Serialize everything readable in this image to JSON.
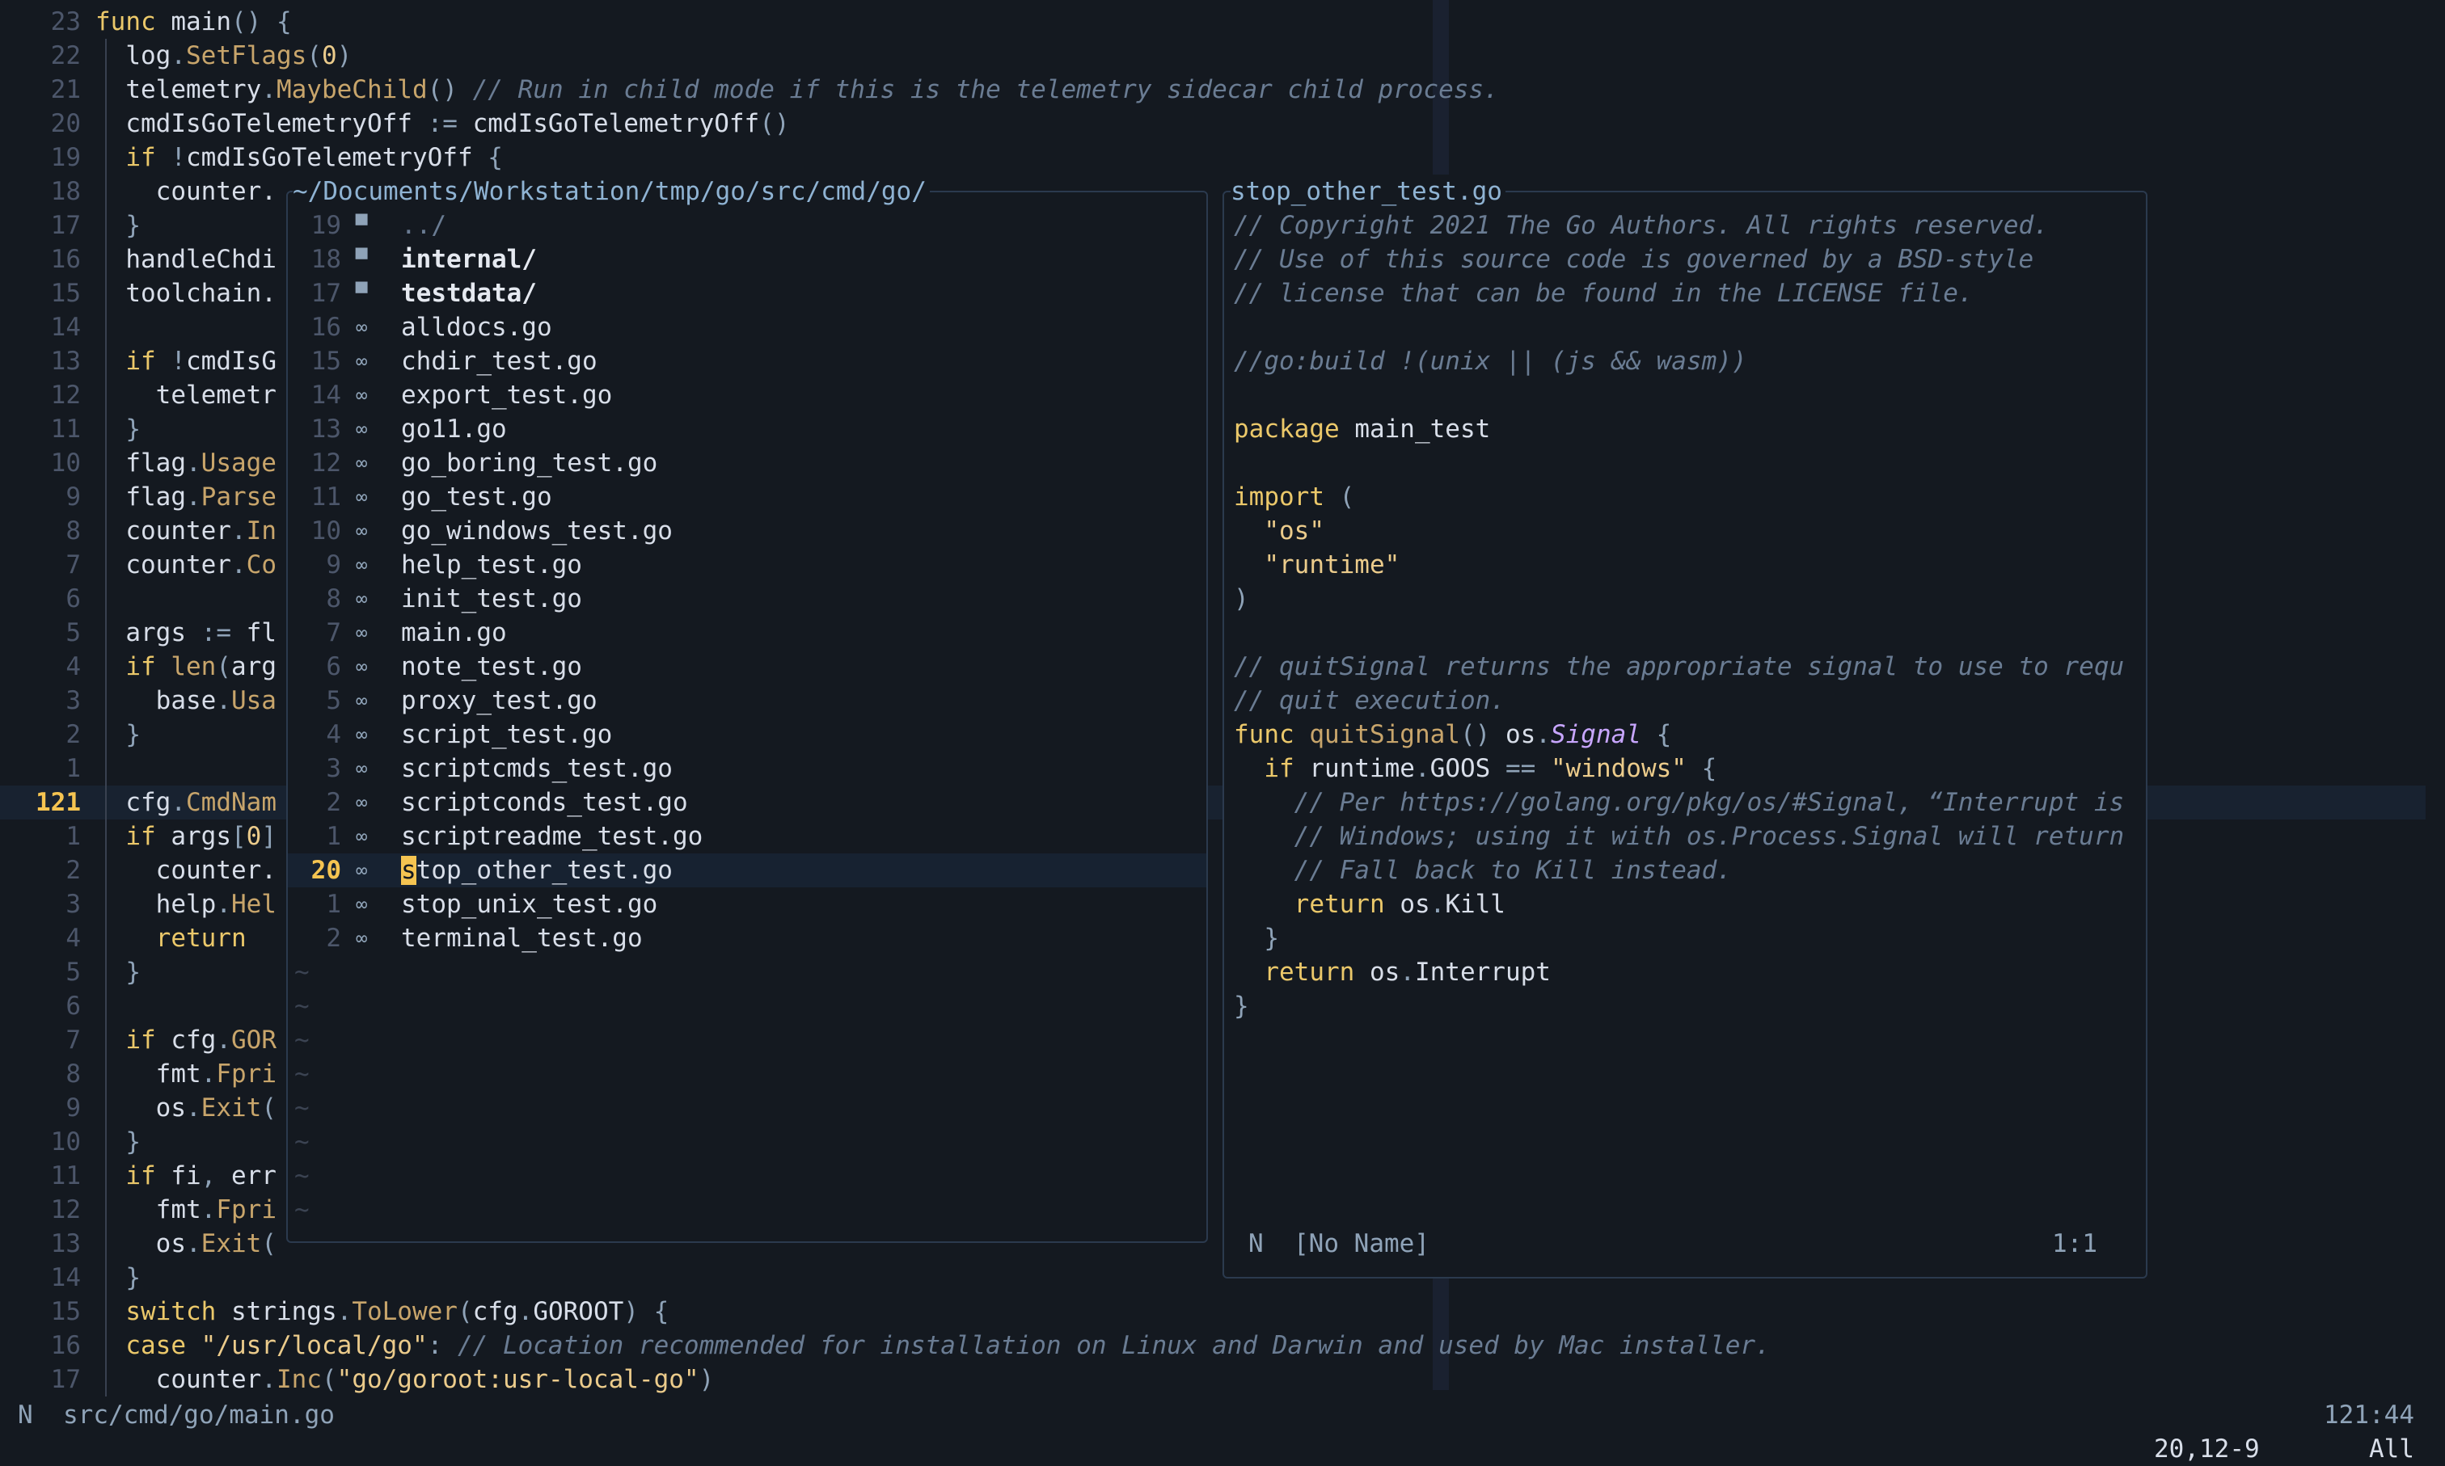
{
  "editor": {
    "cursor_line_number": "121",
    "lines": [
      {
        "n": "23",
        "segs": [
          [
            "kw",
            "func "
          ],
          [
            "",
            "main"
          ],
          [
            "op",
            "() {"
          ]
        ]
      },
      {
        "n": "22",
        "segs": [
          [
            "",
            "  log"
          ],
          [
            "op",
            "."
          ],
          [
            "fn",
            "SetFlags"
          ],
          [
            "op",
            "("
          ],
          [
            "num",
            "0"
          ],
          [
            "op",
            ")"
          ]
        ]
      },
      {
        "n": "21",
        "segs": [
          [
            "",
            "  telemetry"
          ],
          [
            "op",
            "."
          ],
          [
            "fn",
            "MaybeChild"
          ],
          [
            "op",
            "() "
          ],
          [
            "cm",
            "// Run in child mode if this is the telemetry sidecar child process."
          ]
        ]
      },
      {
        "n": "20",
        "segs": [
          [
            "",
            "  cmdIsGoTelemetryOff "
          ],
          [
            "op",
            ":= "
          ],
          [
            "",
            "cmdIsGoTelemetryOff"
          ],
          [
            "op",
            "()"
          ]
        ]
      },
      {
        "n": "19",
        "segs": [
          [
            "kw",
            "  if "
          ],
          [
            "op",
            "!"
          ],
          [
            "",
            "cmdIsGoTelemetryOff "
          ],
          [
            "op",
            "{"
          ]
        ]
      },
      {
        "n": "18",
        "segs": [
          [
            "",
            "    counter."
          ]
        ]
      },
      {
        "n": "17",
        "segs": [
          [
            "op",
            "  }"
          ]
        ]
      },
      {
        "n": "16",
        "segs": [
          [
            "",
            "  handleChdi"
          ]
        ]
      },
      {
        "n": "15",
        "segs": [
          [
            "",
            "  toolchain."
          ]
        ]
      },
      {
        "n": "14",
        "segs": []
      },
      {
        "n": "13",
        "segs": [
          [
            "kw",
            "  if "
          ],
          [
            "op",
            "!"
          ],
          [
            "",
            "cmdIsG"
          ]
        ]
      },
      {
        "n": "12",
        "segs": [
          [
            "",
            "    telemetr"
          ]
        ]
      },
      {
        "n": "11",
        "segs": [
          [
            "op",
            "  }"
          ]
        ]
      },
      {
        "n": "10",
        "segs": [
          [
            "",
            "  flag"
          ],
          [
            "op",
            "."
          ],
          [
            "fn",
            "Usage"
          ]
        ]
      },
      {
        "n": "9",
        "segs": [
          [
            "",
            "  flag"
          ],
          [
            "op",
            "."
          ],
          [
            "fn",
            "Parse"
          ]
        ]
      },
      {
        "n": "8",
        "segs": [
          [
            "",
            "  counter"
          ],
          [
            "op",
            "."
          ],
          [
            "fn",
            "In"
          ]
        ]
      },
      {
        "n": "7",
        "segs": [
          [
            "",
            "  counter"
          ],
          [
            "op",
            "."
          ],
          [
            "fn",
            "Co"
          ]
        ]
      },
      {
        "n": "6",
        "segs": []
      },
      {
        "n": "5",
        "segs": [
          [
            "",
            "  args "
          ],
          [
            "op",
            ":= "
          ],
          [
            "",
            "fl"
          ]
        ]
      },
      {
        "n": "4",
        "segs": [
          [
            "kw",
            "  if "
          ],
          [
            "fn",
            "len"
          ],
          [
            "op",
            "("
          ],
          [
            "",
            "arg"
          ]
        ]
      },
      {
        "n": "3",
        "segs": [
          [
            "",
            "    base"
          ],
          [
            "op",
            "."
          ],
          [
            "fn",
            "Usa"
          ]
        ]
      },
      {
        "n": "2",
        "segs": [
          [
            "op",
            "  }"
          ]
        ]
      },
      {
        "n": "1",
        "segs": []
      },
      {
        "n": "121",
        "segs": [
          [
            "",
            "  cfg"
          ],
          [
            "op",
            "."
          ],
          [
            "fn",
            "CmdNam"
          ]
        ]
      },
      {
        "n": "1",
        "segs": [
          [
            "kw",
            "  if "
          ],
          [
            "",
            "args"
          ],
          [
            "op",
            "["
          ],
          [
            "num",
            "0"
          ],
          [
            "op",
            "]"
          ]
        ]
      },
      {
        "n": "2",
        "segs": [
          [
            "",
            "    counter."
          ]
        ]
      },
      {
        "n": "3",
        "segs": [
          [
            "",
            "    help"
          ],
          [
            "op",
            "."
          ],
          [
            "fn",
            "Hel"
          ]
        ]
      },
      {
        "n": "4",
        "segs": [
          [
            "kw",
            "    return"
          ]
        ]
      },
      {
        "n": "5",
        "segs": [
          [
            "op",
            "  }"
          ]
        ]
      },
      {
        "n": "6",
        "segs": []
      },
      {
        "n": "7",
        "segs": [
          [
            "kw",
            "  if "
          ],
          [
            "",
            "cfg"
          ],
          [
            "op",
            "."
          ],
          [
            "fn",
            "GOR"
          ]
        ]
      },
      {
        "n": "8",
        "segs": [
          [
            "",
            "    fmt"
          ],
          [
            "op",
            "."
          ],
          [
            "fn",
            "Fpri"
          ]
        ]
      },
      {
        "n": "9",
        "segs": [
          [
            "",
            "    os"
          ],
          [
            "op",
            "."
          ],
          [
            "fn",
            "Exit"
          ],
          [
            "op",
            "("
          ]
        ]
      },
      {
        "n": "10",
        "segs": [
          [
            "op",
            "  }"
          ]
        ]
      },
      {
        "n": "11",
        "segs": [
          [
            "kw",
            "  if "
          ],
          [
            "",
            "fi"
          ],
          [
            "op",
            ", "
          ],
          [
            "",
            "err"
          ]
        ]
      },
      {
        "n": "12",
        "segs": [
          [
            "",
            "    fmt"
          ],
          [
            "op",
            "."
          ],
          [
            "fn",
            "Fpri"
          ]
        ]
      },
      {
        "n": "13",
        "segs": [
          [
            "",
            "    os"
          ],
          [
            "op",
            "."
          ],
          [
            "fn",
            "Exit"
          ],
          [
            "op",
            "("
          ]
        ]
      },
      {
        "n": "14",
        "segs": [
          [
            "op",
            "  }"
          ]
        ]
      },
      {
        "n": "15",
        "segs": [
          [
            "kw",
            "  switch "
          ],
          [
            "",
            "strings"
          ],
          [
            "op",
            "."
          ],
          [
            "fn",
            "ToLower"
          ],
          [
            "op",
            "("
          ],
          [
            "",
            "cfg"
          ],
          [
            "op",
            "."
          ],
          [
            "",
            "GOROOT"
          ],
          [
            "op",
            ") {"
          ]
        ]
      },
      {
        "n": "16",
        "segs": [
          [
            "kw",
            "  case "
          ],
          [
            "str",
            "\"/usr/local/go\""
          ],
          [
            "op",
            ": "
          ],
          [
            "cm",
            "// Location recommended for installation on Linux and Darwin and used by Mac installer."
          ]
        ]
      },
      {
        "n": "17",
        "segs": [
          [
            "",
            "    counter"
          ],
          [
            "op",
            "."
          ],
          [
            "fn",
            "Inc"
          ],
          [
            "op",
            "("
          ],
          [
            "str",
            "\"go/goroot:usr-local-go\""
          ],
          [
            "op",
            ")"
          ]
        ]
      }
    ]
  },
  "watermark": "wallpaper",
  "picker": {
    "path": "~/Documents/Workstation/tmp/go/src/cmd/go/",
    "items": [
      {
        "n": "19",
        "icon": "folder-icon",
        "glyph": "▀",
        "name": "../",
        "kind": "up"
      },
      {
        "n": "18",
        "icon": "folder-icon",
        "glyph": "▀",
        "name": "internal/",
        "kind": "dir"
      },
      {
        "n": "17",
        "icon": "folder-icon",
        "glyph": "▀",
        "name": "testdata/",
        "kind": "dir"
      },
      {
        "n": "16",
        "icon": "go-file-icon",
        "glyph": "∞",
        "name": "alldocs.go",
        "kind": "file"
      },
      {
        "n": "15",
        "icon": "go-file-icon",
        "glyph": "∞",
        "name": "chdir_test.go",
        "kind": "file"
      },
      {
        "n": "14",
        "icon": "go-file-icon",
        "glyph": "∞",
        "name": "export_test.go",
        "kind": "file"
      },
      {
        "n": "13",
        "icon": "go-file-icon",
        "glyph": "∞",
        "name": "go11.go",
        "kind": "file"
      },
      {
        "n": "12",
        "icon": "go-file-icon",
        "glyph": "∞",
        "name": "go_boring_test.go",
        "kind": "file"
      },
      {
        "n": "11",
        "icon": "go-file-icon",
        "glyph": "∞",
        "name": "go_test.go",
        "kind": "file"
      },
      {
        "n": "10",
        "icon": "go-file-icon",
        "glyph": "∞",
        "name": "go_windows_test.go",
        "kind": "file"
      },
      {
        "n": "9",
        "icon": "go-file-icon",
        "glyph": "∞",
        "name": "help_test.go",
        "kind": "file"
      },
      {
        "n": "8",
        "icon": "go-file-icon",
        "glyph": "∞",
        "name": "init_test.go",
        "kind": "file"
      },
      {
        "n": "7",
        "icon": "go-file-icon",
        "glyph": "∞",
        "name": "main.go",
        "kind": "file"
      },
      {
        "n": "6",
        "icon": "go-file-icon",
        "glyph": "∞",
        "name": "note_test.go",
        "kind": "file"
      },
      {
        "n": "5",
        "icon": "go-file-icon",
        "glyph": "∞",
        "name": "proxy_test.go",
        "kind": "file"
      },
      {
        "n": "4",
        "icon": "go-file-icon",
        "glyph": "∞",
        "name": "script_test.go",
        "kind": "file"
      },
      {
        "n": "3",
        "icon": "go-file-icon",
        "glyph": "∞",
        "name": "scriptcmds_test.go",
        "kind": "file"
      },
      {
        "n": "2",
        "icon": "go-file-icon",
        "glyph": "∞",
        "name": "scriptconds_test.go",
        "kind": "file"
      },
      {
        "n": "1",
        "icon": "go-file-icon",
        "glyph": "∞",
        "name": "scriptreadme_test.go",
        "kind": "file"
      },
      {
        "n": "20",
        "icon": "go-file-icon",
        "glyph": "∞",
        "name": "stop_other_test.go",
        "kind": "selected"
      },
      {
        "n": "1",
        "icon": "go-file-icon",
        "glyph": "∞",
        "name": "stop_unix_test.go",
        "kind": "file"
      },
      {
        "n": "2",
        "icon": "go-file-icon",
        "glyph": "∞",
        "name": "terminal_test.go",
        "kind": "file"
      }
    ],
    "empty_marker": "~"
  },
  "preview": {
    "title": "stop_other_test.go",
    "lines": [
      [
        [
          "cm",
          "// Copyright 2021 The Go Authors. All rights reserved."
        ]
      ],
      [
        [
          "cm",
          "// Use of this source code is governed by a BSD-style"
        ]
      ],
      [
        [
          "cm",
          "// license that can be found in the LICENSE file."
        ]
      ],
      [],
      [
        [
          "cm",
          "//go:build !(unix || (js && wasm))"
        ]
      ],
      [],
      [
        [
          "kw",
          "package "
        ],
        [
          "",
          "main_test"
        ]
      ],
      [],
      [
        [
          "kw",
          "import "
        ],
        [
          "op",
          "("
        ]
      ],
      [
        [
          "str",
          "  \"os\""
        ]
      ],
      [
        [
          "str",
          "  \"runtime\""
        ]
      ],
      [
        [
          "op",
          ")"
        ]
      ],
      [],
      [
        [
          "cm",
          "// quitSignal returns the appropriate signal to use to requ"
        ]
      ],
      [
        [
          "cm",
          "// quit execution."
        ]
      ],
      [
        [
          "kw",
          "func "
        ],
        [
          "fn",
          "quitSignal"
        ],
        [
          "op",
          "() "
        ],
        [
          "",
          "os"
        ],
        [
          "op",
          "."
        ],
        [
          "ty",
          "Signal"
        ],
        [
          "op",
          " {"
        ]
      ],
      [
        [
          "kw",
          "  if "
        ],
        [
          "",
          "runtime"
        ],
        [
          "op",
          "."
        ],
        [
          "",
          "GOOS "
        ],
        [
          "op",
          "== "
        ],
        [
          "str",
          "\"windows\""
        ],
        [
          "op",
          " {"
        ]
      ],
      [
        [
          "cm",
          "    // Per https://golang.org/pkg/os/#Signal, “Interrupt is"
        ]
      ],
      [
        [
          "cm",
          "    // Windows; using it with os.Process.Signal will return"
        ]
      ],
      [
        [
          "cm",
          "    // Fall back to Kill instead."
        ]
      ],
      [
        [
          "kw",
          "    return "
        ],
        [
          "",
          "os"
        ],
        [
          "op",
          "."
        ],
        [
          "",
          "Kill"
        ]
      ],
      [
        [
          "op",
          "  }"
        ]
      ],
      [
        [
          "kw",
          "  return "
        ],
        [
          "",
          "os"
        ],
        [
          "op",
          "."
        ],
        [
          "",
          "Interrupt"
        ]
      ],
      [
        [
          "op",
          "}"
        ]
      ]
    ],
    "mode": "N",
    "buffer": "[No Name]",
    "position": "1:1"
  },
  "statusline": {
    "mode": "N",
    "file": "src/cmd/go/main.go",
    "position": "121:44"
  },
  "cmdline": {
    "position": "20,12-9",
    "scroll": "All"
  }
}
